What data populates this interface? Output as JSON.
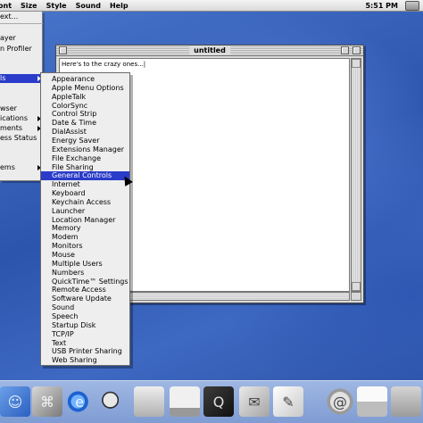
{
  "menubar": {
    "items": [
      "ont",
      "Size",
      "Style",
      "Sound",
      "Help"
    ],
    "clock": "5:51 PM"
  },
  "apple_menu": {
    "items": [
      {
        "label": "ext..."
      },
      {
        "label": "ayer"
      },
      {
        "label": "n Profiler"
      },
      {
        "label": "ls",
        "selected": true,
        "submenu": true
      },
      {
        "label": "wser"
      },
      {
        "label": "ications",
        "submenu": true
      },
      {
        "label": "ments",
        "submenu": true
      },
      {
        "label": "ess Status"
      },
      {
        "label": "ems",
        "submenu": true
      }
    ]
  },
  "window": {
    "title": "untitled",
    "text": "Here's to the crazy ones...|"
  },
  "control_panels": {
    "items": [
      "Appearance",
      "Apple Menu Options",
      "AppleTalk",
      "ColorSync",
      "Control Strip",
      "Date & Time",
      "DialAssist",
      "Energy Saver",
      "Extensions Manager",
      "File Exchange",
      "File Sharing",
      "General Controls",
      "Internet",
      "Keyboard",
      "Keychain Access",
      "Launcher",
      "Location Manager",
      "Memory",
      "Modem",
      "Monitors",
      "Mouse",
      "Multiple Users",
      "Numbers",
      "QuickTime™ Settings",
      "Remote Access",
      "Software Update",
      "Sound",
      "Speech",
      "Startup Disk",
      "TCP/IP",
      "Text",
      "USB Printer Sharing",
      "Web Sharing"
    ],
    "selected": "General Controls"
  },
  "dock": {
    "icons": [
      "finder-icon",
      "mac-os-icon",
      "internet-explorer-icon",
      "sherlock-icon",
      "apple-system-profiler-icon",
      "monitor-icon",
      "quicktime-icon",
      "mail-icon",
      "write-icon",
      "email-at-icon",
      "printer-icon",
      "folder-icon"
    ]
  }
}
